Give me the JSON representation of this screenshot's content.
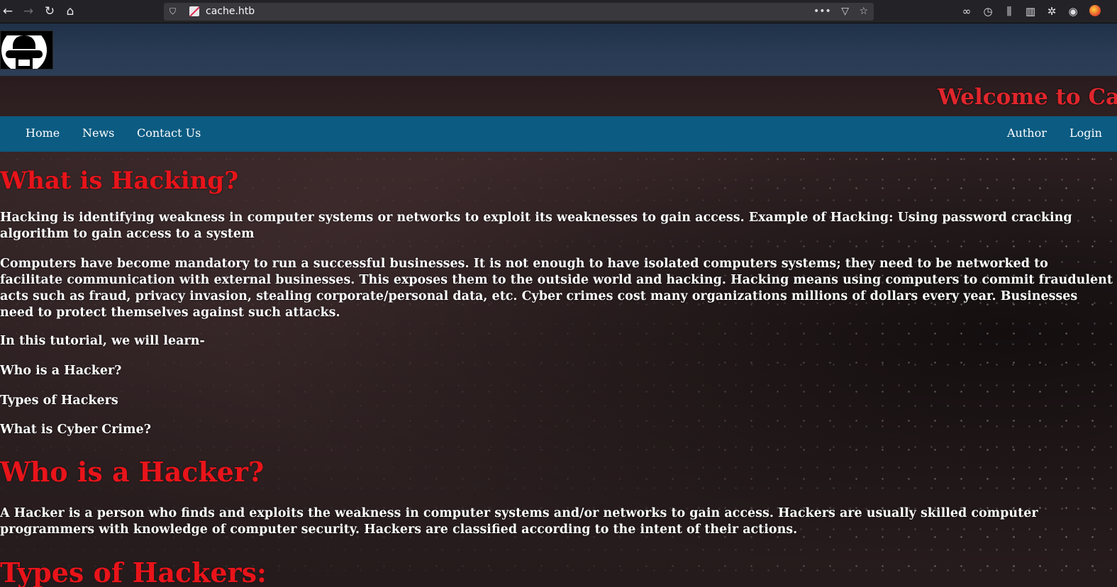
{
  "browser": {
    "url": "cache.htb",
    "back_icon": "arrow-left-icon",
    "forward_icon": "arrow-right-icon",
    "reload_icon": "reload-icon",
    "home_icon": "home-icon",
    "more_label": "•••"
  },
  "site": {
    "welcome_text": "Welcome to Cache",
    "nav_left": [
      "Home",
      "News",
      "Contact Us"
    ],
    "nav_right": [
      "Author",
      "Login"
    ],
    "colors": {
      "nav_bar": "#0b5b82",
      "heading_red": "#e8141a",
      "banner_red": "#e0262c"
    }
  },
  "article": {
    "h1": "What is Hacking?",
    "p1": "Hacking is identifying weakness in computer systems or networks to exploit its weaknesses to gain access. Example of Hacking: Using password cracking algorithm to gain access to a system",
    "p2": "Computers have become mandatory to run a successful businesses. It is not enough to have isolated computers systems; they need to be networked to facilitate communication with external businesses. This exposes them to the outside world and hacking. Hacking means using computers to commit fraudulent acts such as fraud, privacy invasion, stealing corporate/personal data, etc. Cyber crimes cost many organizations millions of dollars every year. Businesses need to protect themselves against such attacks.",
    "p3": "In this tutorial, we will learn-",
    "toc": [
      "Who is a Hacker?",
      "Types of Hackers",
      "What is Cyber Crime?"
    ],
    "h2": "Who is a Hacker?",
    "p4": "A Hacker is a person who finds and exploits the weakness in computer systems and/or networks to gain access. Hackers are usually skilled computer programmers with knowledge of computer security. Hackers are classified according to the intent of their actions.",
    "h3": "Types of Hackers:"
  }
}
